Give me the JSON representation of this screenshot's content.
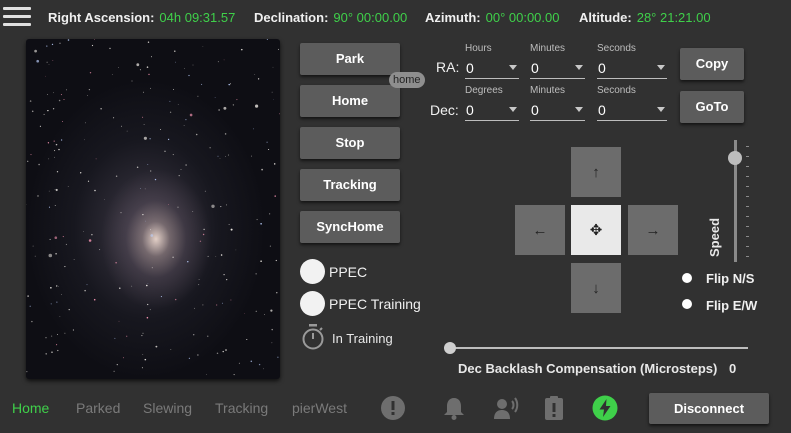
{
  "header": {
    "ra_label": "Right Ascension:",
    "ra_value": "04h 09:31.57",
    "dec_label": "Declination:",
    "dec_value": "90° 00:00.00",
    "az_label": "Azimuth:",
    "az_value": "00° 00:00.00",
    "alt_label": "Altitude:",
    "alt_value": "28° 21:21.00"
  },
  "buttons": {
    "park": "Park",
    "home": "Home",
    "home_tooltip": "home",
    "stop": "Stop",
    "tracking": "Tracking",
    "synchome": "SyncHome"
  },
  "ppec": {
    "ppec_label": "PPEC",
    "ppec_training_label": "PPEC Training",
    "in_training_label": "In Training"
  },
  "goto": {
    "ra_label": "RA:",
    "dec_label": "Dec:",
    "hours_cap": "Hours",
    "hours_val": "0",
    "ra_min_cap": "Minutes",
    "ra_min_val": "0",
    "ra_sec_cap": "Seconds",
    "ra_sec_val": "0",
    "deg_cap": "Degrees",
    "deg_val": "0",
    "dec_min_cap": "Minutes",
    "dec_min_val": "0",
    "dec_sec_cap": "Seconds",
    "dec_sec_val": "0",
    "copy": "Copy",
    "goto": "GoTo"
  },
  "motion": {
    "up": "↑",
    "down": "↓",
    "left": "←",
    "right": "→",
    "center": "✥",
    "speed_label": "Speed",
    "speed_level": 0.85
  },
  "flip": {
    "ns": "Flip N/S",
    "ew": "Flip E/W"
  },
  "backlash": {
    "label": "Dec Backlash Compensation (Microsteps)",
    "value": "0"
  },
  "statusbar": {
    "home": "Home",
    "parked": "Parked",
    "slewing": "Slewing",
    "tracking": "Tracking",
    "pier": "pierWest",
    "disconnect": "Disconnect",
    "active_color": "#3fd04a",
    "inactive_color": "#7a7a7a"
  },
  "icons": [
    "menu-icon",
    "timer-icon",
    "alert-icon",
    "bell-icon",
    "voice-icon",
    "clipboard-alert-icon",
    "power-bolt-icon"
  ]
}
